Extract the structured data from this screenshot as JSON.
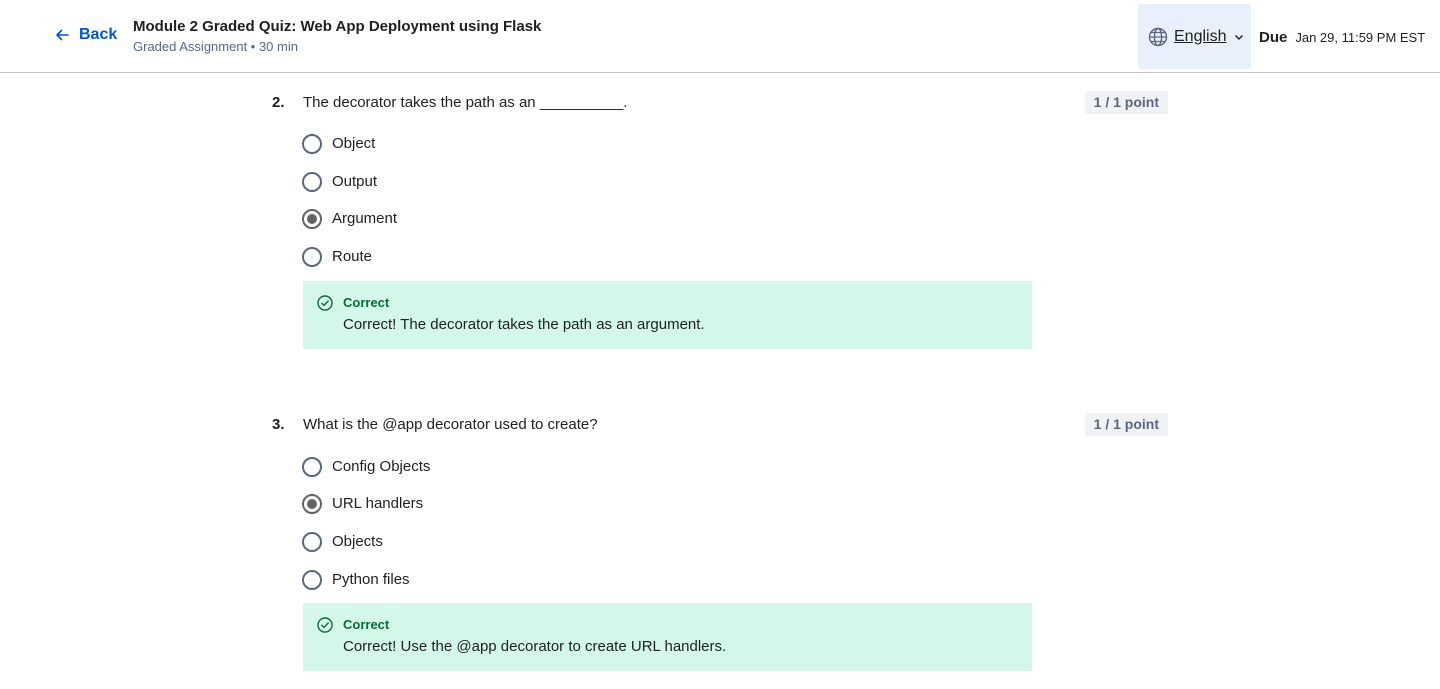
{
  "header": {
    "back_label": "Back",
    "title": "Module 2 Graded Quiz: Web App Deployment using Flask",
    "subtitle": "Graded Assignment • 30 min",
    "language": "English",
    "due_label": "Due",
    "due_date": "Jan 29, 11:59 PM EST"
  },
  "questions": [
    {
      "number": "2.",
      "text": "The decorator takes the path as an __________.",
      "points": "1 / 1 point",
      "options": [
        "Object",
        "Output",
        "Argument",
        "Route"
      ],
      "selected": "Argument",
      "feedback": {
        "title": "Correct",
        "text": "Correct! The decorator takes the path as an argument."
      }
    },
    {
      "number": "3.",
      "text": "What is the @app decorator used to create?",
      "points": "1 / 1 point",
      "options": [
        "Config Objects",
        "URL handlers",
        "Objects",
        "Python files"
      ],
      "selected": "URL handlers",
      "feedback": {
        "title": "Correct",
        "text": "Correct! Use the @app decorator to create URL handlers."
      }
    }
  ],
  "colors": {
    "accent": "#0056d2",
    "correct_bg": "#d3f8ea",
    "correct_text": "#0b6b3a"
  }
}
